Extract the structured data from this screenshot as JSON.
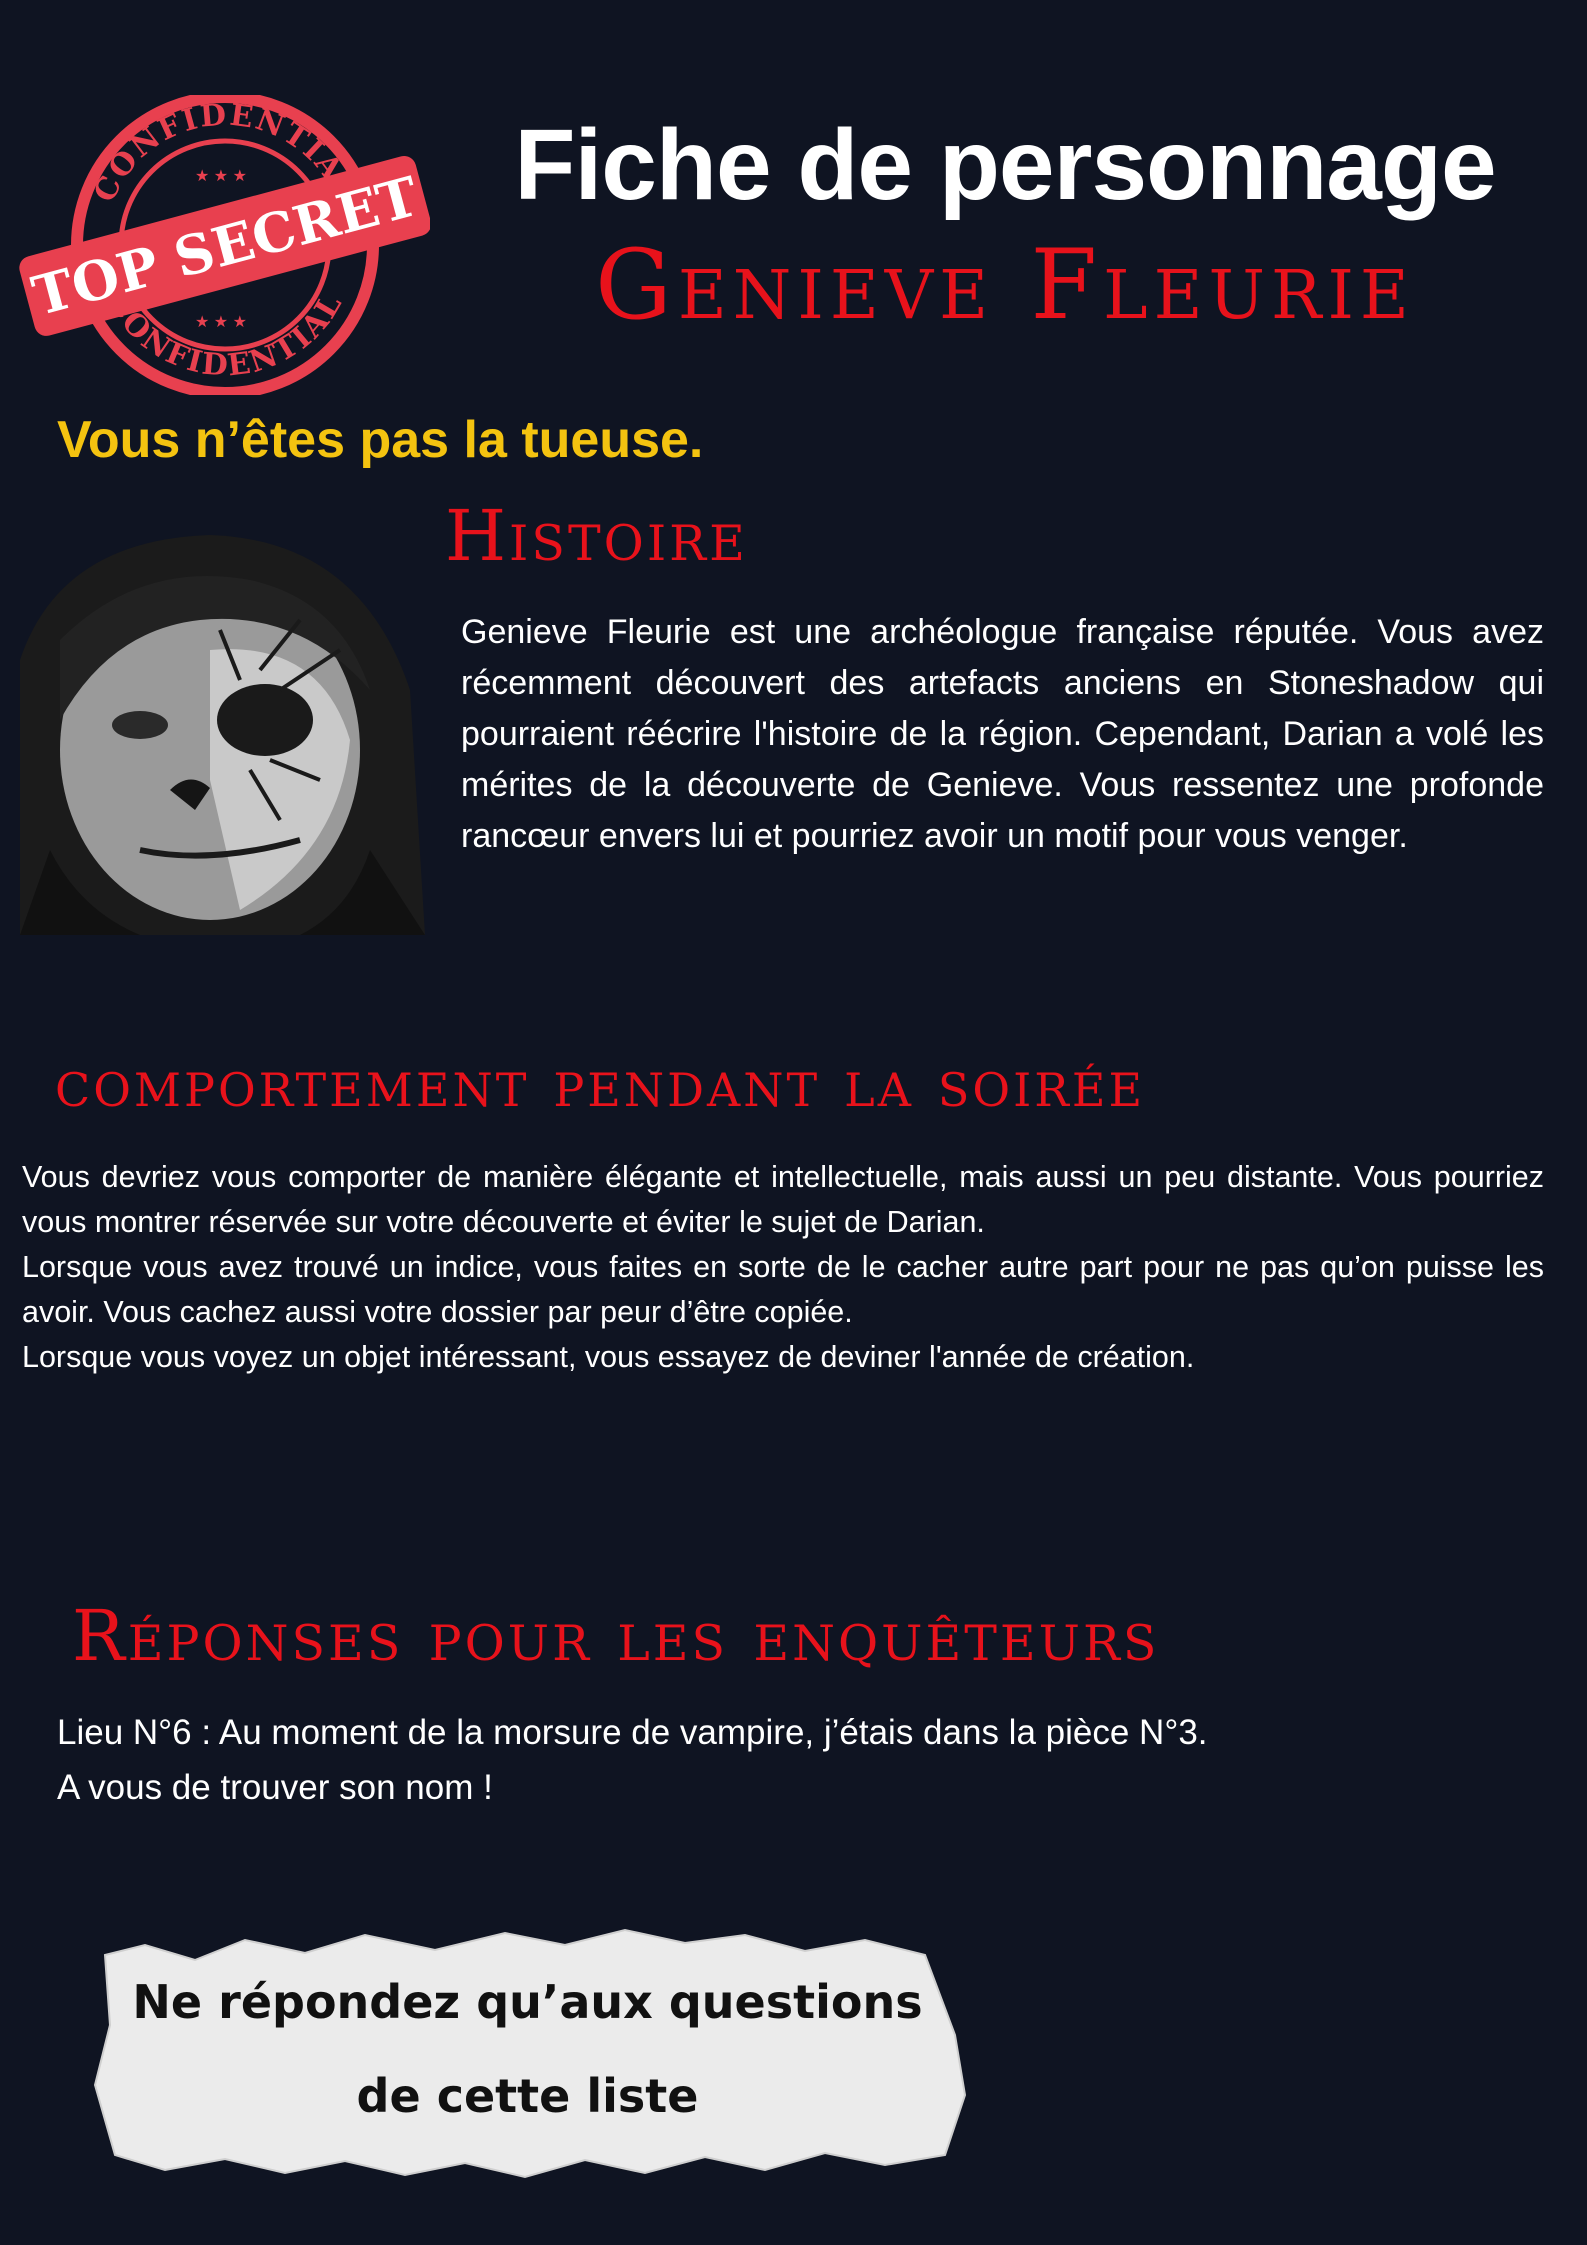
{
  "stamp": {
    "top_text": "CONFIDENTIAL",
    "bottom_text": "CONFIDENTIAL",
    "banner": "TOP SECRET",
    "color": "#e8404f"
  },
  "header": {
    "title": "Fiche de personnage",
    "name": "Genieve Fleurie"
  },
  "subtitle": "Vous n’êtes pas la tueuse.",
  "histoire": {
    "heading": "Histoire",
    "text": "Genieve Fleurie est une archéologue française réputée. Vous avez récemment découvert des artefacts anciens en Stoneshadow qui pourraient réécrire l'histoire de la région. Cependant, Darian a volé les mérites de la découverte de Genieve. Vous ressentez une profonde rancœur envers lui et pourriez avoir un motif pour vous venger."
  },
  "comportement": {
    "heading": "comportement pendant la soirée",
    "paragraphs": [
      "Vous devriez vous comporter de manière élégante et intellectuelle, mais aussi un peu distante. Vous pourriez vous montrer réservée sur votre découverte et éviter le sujet de Darian.",
      "Lorsque vous avez trouvé un indice, vous faites en sorte de le cacher autre part pour ne pas qu’on puisse les avoir. Vous cachez aussi votre dossier par peur d’être copiée.",
      "Lorsque vous voyez un objet intéressant, vous essayez de deviner l'année de création."
    ]
  },
  "reponses": {
    "heading": "Réponses pour les enquêteurs",
    "lines": [
      "Lieu N°6 : Au moment de la morsure de vampire, j’étais dans la pièce N°3.",
      "A vous de trouver son nom !"
    ]
  },
  "note": {
    "lines": [
      "Ne répondez qu’aux questions",
      "de cette liste"
    ]
  },
  "colors": {
    "background": "#0f1422",
    "accent_red": "#e8121b",
    "accent_yellow": "#f4c310",
    "text": "#ffffff"
  }
}
